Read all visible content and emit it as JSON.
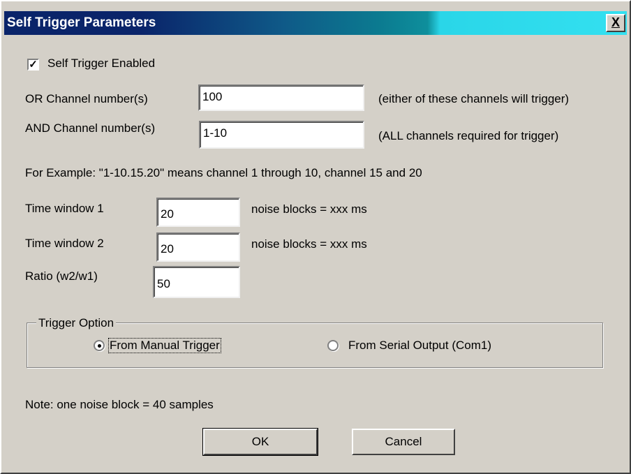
{
  "window": {
    "title": "Self Trigger Parameters",
    "close_glyph": "X"
  },
  "self_trigger": {
    "label": "Self Trigger Enabled",
    "checked": true,
    "check_glyph": "✓"
  },
  "or_channels": {
    "label": "OR Channel number(s)",
    "value": "100",
    "hint": "(either of these channels will trigger)"
  },
  "and_channels": {
    "label": "AND Channel number(s)",
    "value": "1-10",
    "hint": "(ALL channels required for trigger)"
  },
  "example_text": "For Example: \"1-10.15.20\" means channel 1 through 10, channel 15 and 20",
  "time_window_1": {
    "label": "Time window 1",
    "value": "20",
    "suffix": "noise blocks  = xxx ms"
  },
  "time_window_2": {
    "label": "Time window 2",
    "value": "20",
    "suffix": "noise blocks  = xxx ms"
  },
  "ratio": {
    "label": "Ratio (w2/w1)",
    "value": "50"
  },
  "trigger_option": {
    "group_label": "Trigger Option",
    "options": [
      {
        "label": "From Manual Trigger",
        "selected": true
      },
      {
        "label": "From Serial Output (Com1)",
        "selected": false
      }
    ]
  },
  "note_text": "Note: one noise block = 40 samples",
  "buttons": {
    "ok_label": "OK",
    "cancel_label": "Cancel"
  },
  "colors": {
    "titlebar_start": "#0a246a",
    "titlebar_end": "#33e0f0",
    "dialog_face": "#d4d0c8"
  }
}
